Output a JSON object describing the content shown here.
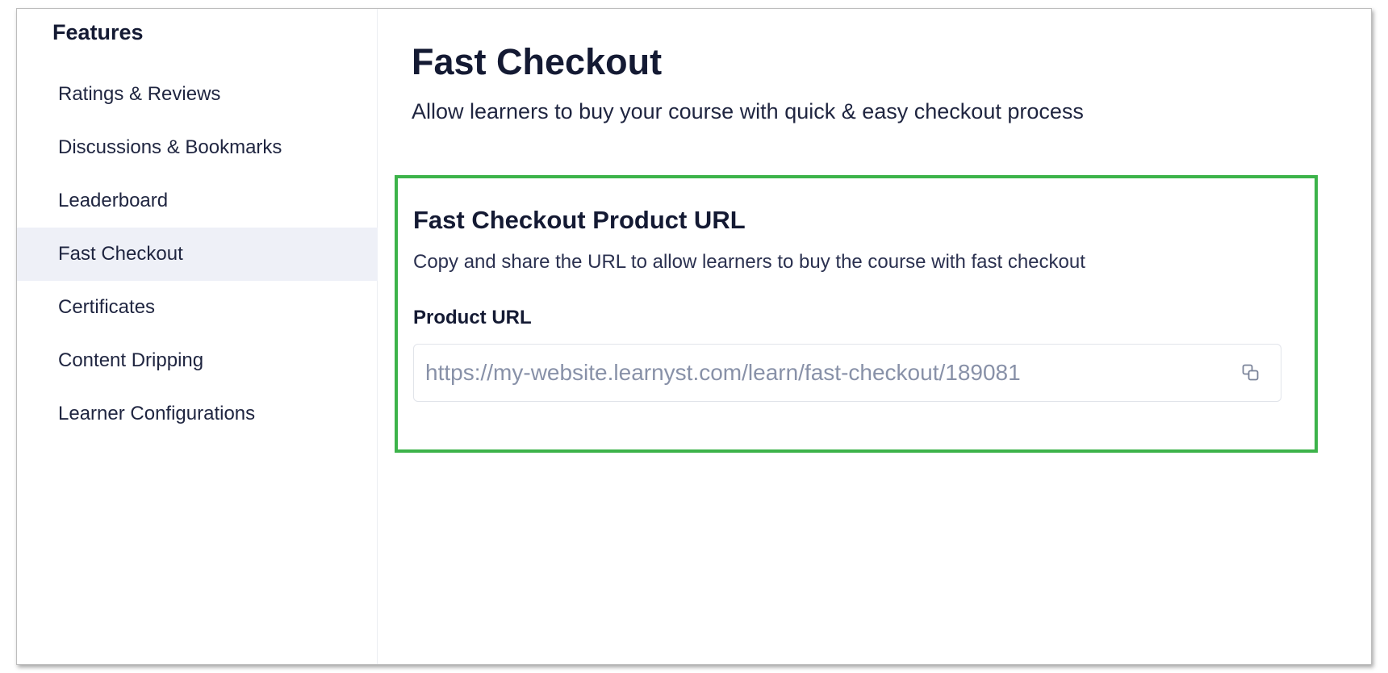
{
  "sidebar": {
    "heading": "Features",
    "items": [
      {
        "label": "Ratings & Reviews",
        "active": false
      },
      {
        "label": "Discussions & Bookmarks",
        "active": false
      },
      {
        "label": "Leaderboard",
        "active": false
      },
      {
        "label": "Fast Checkout",
        "active": true
      },
      {
        "label": "Certificates",
        "active": false
      },
      {
        "label": "Content Dripping",
        "active": false
      },
      {
        "label": "Learner Configurations",
        "active": false
      }
    ]
  },
  "main": {
    "title": "Fast Checkout",
    "subtitle": "Allow learners to buy your course with quick & easy checkout process",
    "card": {
      "title": "Fast Checkout Product URL",
      "description": "Copy and share the URL to allow learners to buy the course with fast checkout",
      "field_label": "Product URL",
      "url_value": "https://my-website.learnyst.com/learn/fast-checkout/189081",
      "copy_icon": "copy-icon"
    }
  },
  "colors": {
    "highlight_border": "#3cb34a",
    "active_nav_bg": "#eef0f7",
    "url_text": "#8891a8"
  }
}
